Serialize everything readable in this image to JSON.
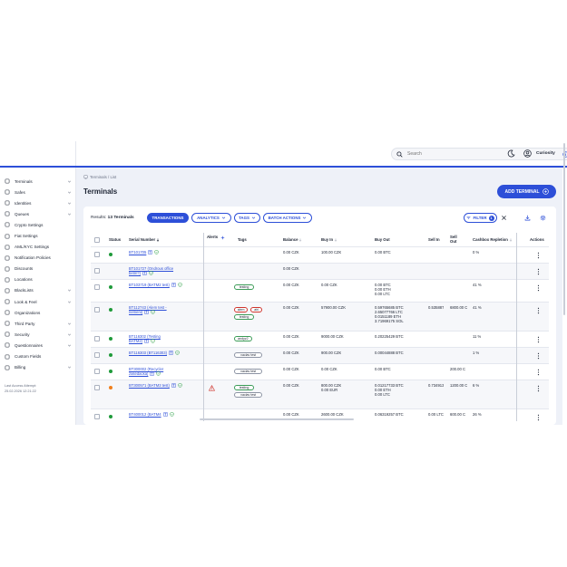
{
  "colors": {
    "accent": "#2d4fd8",
    "online": "#1f9a3a",
    "warning": "#f07f1c",
    "alert": "#d0342c"
  },
  "header": {
    "search_placeholder": "Search",
    "user_name": "Curiosity",
    "icons": [
      "search-icon",
      "info-icon",
      "moon-icon",
      "user-avatar-icon"
    ]
  },
  "sidebar": {
    "items": [
      {
        "label": "Terminals",
        "icon": "terminal-icon",
        "expandable": true
      },
      {
        "label": "Safes",
        "icon": "safe-icon",
        "expandable": true
      },
      {
        "label": "Identities",
        "icon": "identity-icon",
        "expandable": true
      },
      {
        "label": "Queues",
        "icon": "queue-icon",
        "expandable": true
      },
      {
        "label": "Crypto Settings",
        "icon": "crypto-icon",
        "expandable": false
      },
      {
        "label": "Fiat Settings",
        "icon": "fiat-icon",
        "expandable": false
      },
      {
        "label": "AML/KYC Settings",
        "icon": "aml-icon",
        "expandable": false
      },
      {
        "label": "Notification Policies",
        "icon": "bell-icon",
        "expandable": false
      },
      {
        "label": "Discounts",
        "icon": "discount-icon",
        "expandable": false
      },
      {
        "label": "Locations",
        "icon": "location-icon",
        "expandable": false
      },
      {
        "label": "BlackLists",
        "icon": "blacklist-icon",
        "expandable": true
      },
      {
        "label": "Look & Feel",
        "icon": "brush-icon",
        "expandable": true
      },
      {
        "label": "Organizations",
        "icon": "organization-icon",
        "expandable": false
      },
      {
        "label": "Third Party",
        "icon": "thirdparty-icon",
        "expandable": true
      },
      {
        "label": "Security",
        "icon": "shield-icon",
        "expandable": true
      },
      {
        "label": "Questionnaires",
        "icon": "questionnaire-icon",
        "expandable": true
      },
      {
        "label": "Custom Fields",
        "icon": "fields-icon",
        "expandable": false
      },
      {
        "label": "Billing",
        "icon": "billing-icon",
        "expandable": true
      }
    ],
    "last_access_label": "Last Access Attempt:",
    "last_access_value": "25.02.2026 12:21:22"
  },
  "main": {
    "breadcrumb": "Terminals / List",
    "title": "Terminals",
    "add_button": "ADD TERMINAL",
    "results_prefix": "Results:",
    "results_count": "13 Terminals",
    "toolbar": {
      "transactions": "TRANSACTIONS",
      "analytics": "ANALYTICS",
      "tags": "TAGS",
      "batch": "BATCH ACTIONS",
      "filter": "FILTER",
      "filter_count": "1"
    },
    "columns": {
      "status": "Status",
      "serial": "Serial Number",
      "alerts": "Alerts",
      "tags": "Tags",
      "balance": "Balance",
      "buy_in": "Buy In",
      "buy_out": "Buy Out",
      "sell_in": "Sell In",
      "sell_out_1": "Sell",
      "sell_out_2": "Out",
      "cashbox": "Cashbox Repletion",
      "actions": "Actions"
    },
    "rows": [
      {
        "status": "online",
        "serial": [
          "BT101705"
        ],
        "tags": [],
        "balance": "0.00 CZK",
        "buy_in": "100.00 CZK",
        "buy_out": [
          "0.00 BTC"
        ],
        "sell_in": "",
        "sell_out": "",
        "cashbox": "0 %",
        "alert": false
      },
      {
        "status": "none",
        "serial": [
          "BT101727 (Ondrous office",
          "betm?)"
        ],
        "tags": [],
        "balance": "0.00 CZK",
        "buy_in": "",
        "buy_out": [],
        "sell_in": "",
        "sell_out": "",
        "cashbox": "",
        "alert": false
      },
      {
        "status": "online",
        "serial": [
          "BT103719 (BATM2 test)"
        ],
        "tags": [
          {
            "text": "testing",
            "color": "green"
          }
        ],
        "balance": "0.00 CZK",
        "buy_in": "0.00 CZK",
        "buy_out": [
          "0.00 BTC",
          "0.00 ETH",
          "0.00 LTC"
        ],
        "sell_in": "",
        "sell_out": "",
        "cashbox": "41 %",
        "alert": false
      },
      {
        "status": "online",
        "serial": [
          "BT112743 (Alem test -",
          "nemeni)"
        ],
        "tags": [
          {
            "text": "alem",
            "color": "red"
          },
          {
            "text": "ahl",
            "color": "red"
          },
          {
            "text": "testing",
            "color": "green"
          }
        ],
        "balance": "0.00 CZK",
        "buy_in": "57900.00 CZK",
        "buy_out": [
          "0.59765685 BTC",
          "2.65077766 LTC",
          "0.0151189 ETH",
          "3.71969175 SOL"
        ],
        "sell_in": "0.535887",
        "sell_out": "6800.00 C",
        "cashbox": "41 %",
        "alert": false
      },
      {
        "status": "online",
        "serial": [
          "BT116302 (Testing",
          "BATM2)"
        ],
        "tags": [
          {
            "text": "andyz2",
            "color": "green"
          }
        ],
        "balance": "0.00 CZK",
        "buy_in": "9000.00 CZK",
        "buy_out": [
          "0.20225429 BTC"
        ],
        "sell_in": "",
        "sell_out": "",
        "cashbox": "11 %",
        "alert": false
      },
      {
        "status": "online",
        "serial": [
          "BT116303 (BT116303)"
        ],
        "tags": [
          {
            "text": "vaclav test",
            "color": "grey"
          }
        ],
        "balance": "0.00 CZK",
        "buy_in": "900.00 CZK",
        "buy_out": [
          "0.00044888 BTC"
        ],
        "sell_in": "",
        "sell_out": "",
        "cashbox": "1 %",
        "alert": false
      },
      {
        "status": "online",
        "serial": [
          "BT300002 (Recycler",
          "zasedacka)"
        ],
        "tags": [
          {
            "text": "vaclav test",
            "color": "grey"
          }
        ],
        "balance": "0.00 CZK",
        "buy_in": "0.00 CZK",
        "buy_out": [
          "0.00 BTC"
        ],
        "sell_in": "",
        "sell_out": "200.00 C",
        "cashbox": "",
        "alert": false
      },
      {
        "status": "warning",
        "serial": [
          "BT300571 (BATM3 test)"
        ],
        "tags": [
          {
            "text": "testing",
            "color": "green"
          },
          {
            "text": "vaclav test",
            "color": "grey"
          }
        ],
        "balance": "0.00 CZK",
        "buy_in": "800.00 CZK",
        "buy_in_2": "0.00 EUR",
        "buy_out": [
          "0.01217733 BTC",
          "0.00 ETH",
          "0.00 LTC"
        ],
        "sell_in": "0.734913",
        "sell_out": "1200.00 C",
        "cashbox": "6 %",
        "alert": true
      },
      {
        "status": "online",
        "serial": [
          "BT400012 (BATM4",
          ""
        ],
        "tags": [],
        "balance": "0.00 CZK",
        "buy_in": "2600.00 CZK",
        "buy_out": [
          "0.06319257 BTC"
        ],
        "sell_in": "0.00 LTC",
        "sell_out": "600.00 C",
        "cashbox": "26 %",
        "alert": false
      }
    ]
  }
}
